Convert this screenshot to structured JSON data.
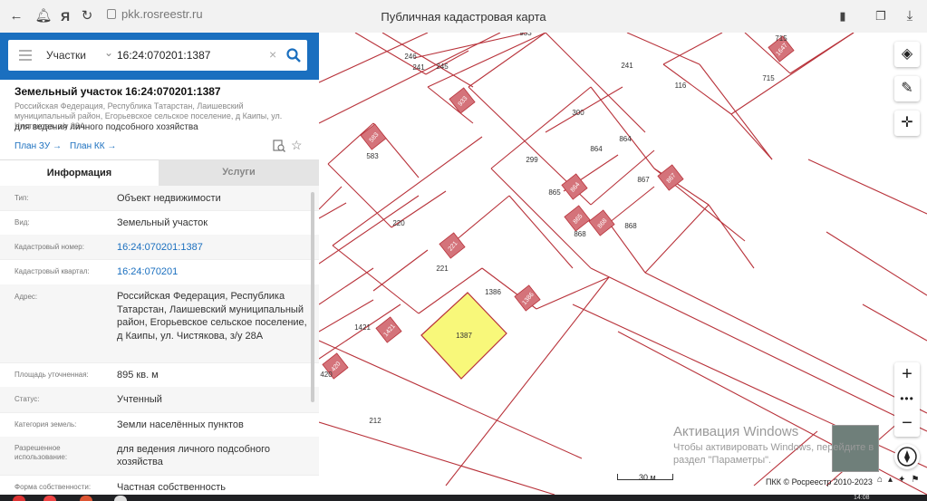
{
  "browser": {
    "url": "pkk.rosreestr.ru",
    "page_title": "Публичная кадастровая карта"
  },
  "search": {
    "type": "Участки",
    "value": "16:24:070201:1387"
  },
  "parcel": {
    "title": "Земельный участок 16:24:070201:1387",
    "address_line": "Российская Федерация, Республика Татарстан, Лаишевский муниципальный район, Егорьевское сельское поселение, д Каипы, ул. Чистякова, з/у 28А",
    "purpose": "для ведения личного подсобного хозяйства",
    "link_plan_zu": "План ЗУ →",
    "link_plan_kk": "План КК →"
  },
  "tabs": {
    "info": "Информация",
    "services": "Услуги"
  },
  "fields": [
    {
      "label": "Тип:",
      "value": "Объект недвижимости"
    },
    {
      "label": "Вид:",
      "value": "Земельный участок"
    },
    {
      "label": "Кадастровый номер:",
      "value": "16:24:070201:1387"
    },
    {
      "label": "Кадастровый квартал:",
      "value": "16:24:070201"
    },
    {
      "label": "Адрес:",
      "value": "Российская Федерация, Республика Татарстан, Лаишевский муниципальный район, Егорьевское сельское поселение, д Каипы, ул. Чистякова, з/у 28А"
    },
    {
      "label": "Площадь уточненная:",
      "value": "895 кв. м"
    },
    {
      "label": "Статус:",
      "value": "Учтенный"
    },
    {
      "label": "Категория земель:",
      "value": "Земли населённых пунктов"
    },
    {
      "label": "Разрешенное использование:",
      "value": "для ведения личного подсобного хозяйства"
    },
    {
      "label": "Форма собственности:",
      "value": "Частная собственность"
    }
  ],
  "map": {
    "parcel_labels": [
      "933",
      "246",
      "245",
      "241",
      "241",
      "715",
      "715",
      "116",
      "300",
      "864",
      "864",
      "583",
      "299",
      "867",
      "865",
      "220",
      "868",
      "868",
      "221",
      "1386",
      "1387",
      "1421",
      "420",
      "212"
    ],
    "building_labels": [
      "933",
      "583",
      "1647",
      "864",
      "867",
      "865",
      "868",
      "221",
      "1386",
      "1421",
      "420"
    ],
    "scale_label": "30 м",
    "copyright": "ПКК © Росреестр 2010-2023",
    "highlight_color": "#f8f87a",
    "line_color": "#b8323a",
    "building_color": "#d4737a"
  },
  "watermark": {
    "line1": "Активация Windows",
    "line2": "Чтобы активировать Windows, перейдите в раздел \"Параметры\"."
  },
  "taskbar": {
    "time": "14:08"
  }
}
